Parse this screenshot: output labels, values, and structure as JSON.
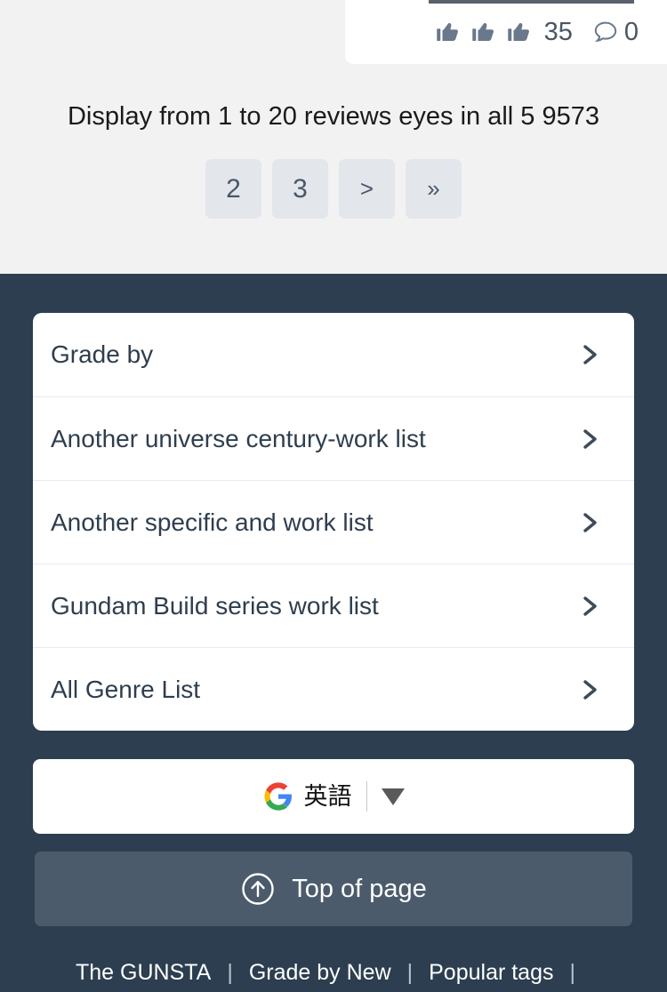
{
  "review_card": {
    "reactions": [
      {
        "icon": "thumbs-up-icon"
      },
      {
        "icon": "thumbs-up-icon"
      },
      {
        "icon": "thumbs-up-icon"
      }
    ],
    "like_count": "35",
    "comment_icon": "comment-bubble-icon",
    "comment_count": "0"
  },
  "results": {
    "summary": "Display from 1 to 20 reviews eyes in all 5 9573"
  },
  "pagination": {
    "buttons": [
      {
        "label": "2",
        "name": "page-2"
      },
      {
        "label": "3",
        "name": "page-3"
      },
      {
        "label": ">",
        "name": "page-next"
      },
      {
        "label": "»",
        "name": "page-last"
      }
    ]
  },
  "menu": {
    "items": [
      {
        "label": "Grade by",
        "icon": "chevron-right-icon"
      },
      {
        "label": "Another universe century-work list",
        "icon": "chevron-right-icon"
      },
      {
        "label": "Another specific and work list",
        "icon": "chevron-right-icon"
      },
      {
        "label": "Gundam Build series work list",
        "icon": "chevron-right-icon"
      },
      {
        "label": "All Genre List",
        "icon": "chevron-right-icon"
      }
    ]
  },
  "translate": {
    "logo": "google-logo-icon",
    "language": "英語",
    "caret": "caret-down-icon"
  },
  "top_of_page": {
    "icon": "arrow-up-circle-icon",
    "label": "Top of page"
  },
  "footer": {
    "links": [
      {
        "label": "The GUNSTA"
      },
      {
        "label": "Grade by New"
      },
      {
        "label": "Popular tags"
      }
    ],
    "divider": "|",
    "trailing_divider": "|"
  },
  "colors": {
    "page_background": "#f2f2f3",
    "dark_background": "#2c3e50",
    "card_background": "#ffffff",
    "pagination_button": "#e3e6eb",
    "pagination_text": "#49586a",
    "top_button": "#4b5b6b",
    "menu_text": "#2f3e4e",
    "icon_gray": "#69788a"
  }
}
